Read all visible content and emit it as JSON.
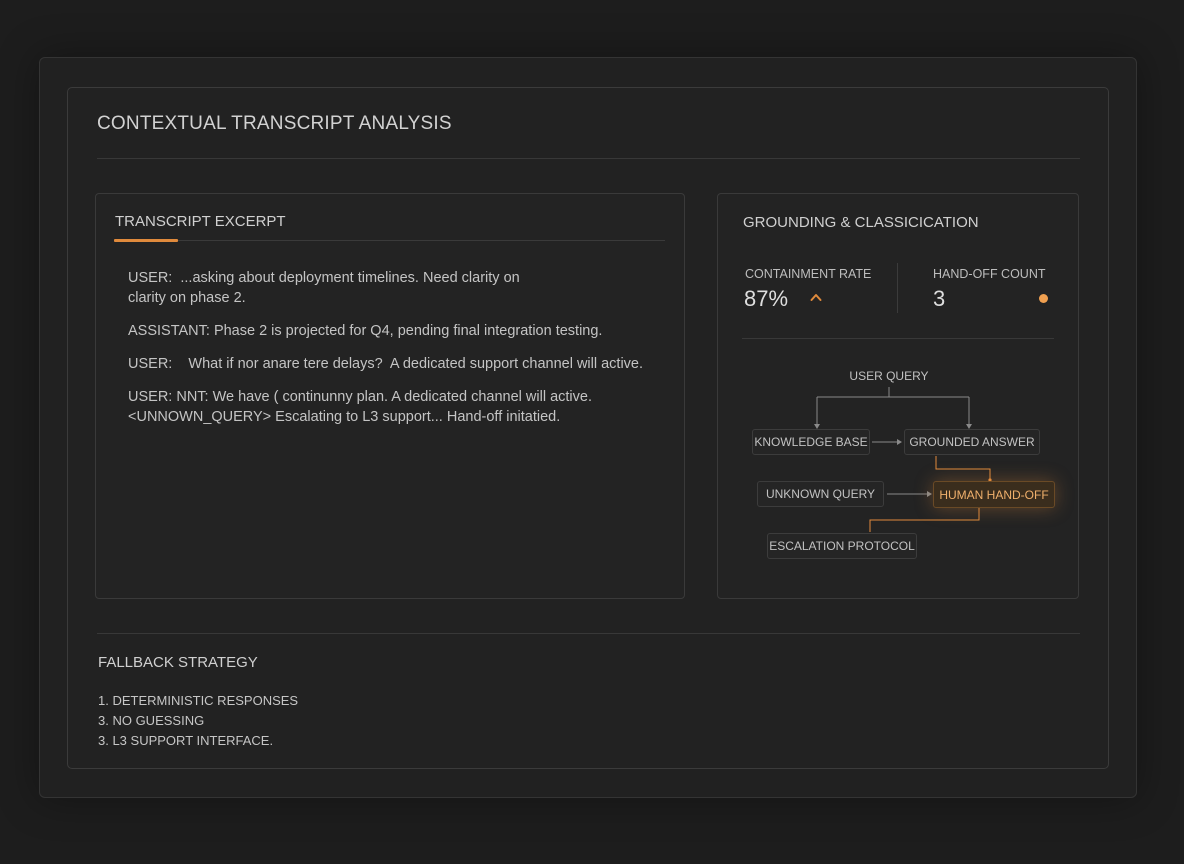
{
  "title": "CONTEXTUAL TRANSCRIPT ANALYSIS",
  "transcript": {
    "heading": "TRANSCRIPT EXCERPT",
    "lines": [
      "USER:  ...asking about deployment timelines. Need clarity on",
      "clarity on phase 2.",
      "ASSISTANT: Phase 2 is projected for Q4, pending final integration testing.",
      "USER:    What if nor anare tere delays?  A dedicated support channel will active.",
      "USER: NNT: We have ( continunny plan. A dedicated channel will active.",
      "<UNNOWN_QUERY> Escalating to L3 support... Hand-off initatied."
    ]
  },
  "grounding": {
    "heading": "GROUNDING & CLASSICICATION",
    "containment_label": "CONTAINMENT RATE",
    "containment_value": "87%",
    "handoff_label": "HAND-OFF COUNT",
    "handoff_value": "3",
    "flow": {
      "user_query": "USER QUERY",
      "knowledge_base": "KNOWLEDGE BASE",
      "grounded_answer": "GROUNDED ANSWER",
      "unknown_query": "UNKNOWN QUERY",
      "human_handoff": "HUMAN HAND-OFF",
      "escalation_protocol": "ESCALATION PROTOCOL"
    }
  },
  "fallback": {
    "heading": "FALLBACK STRATEGY",
    "items": [
      "1. DETERMINISTIC RESPONSES",
      "3. NO GUESSING",
      "3. L3 SUPPORT INTERFACE."
    ]
  },
  "colors": {
    "accent": "#e08a3c",
    "background": "#1d1d1d",
    "panel": "#232323"
  },
  "icons": {
    "containment_trend": "chevron-up-icon",
    "handoff_status": "status-dot-icon"
  }
}
